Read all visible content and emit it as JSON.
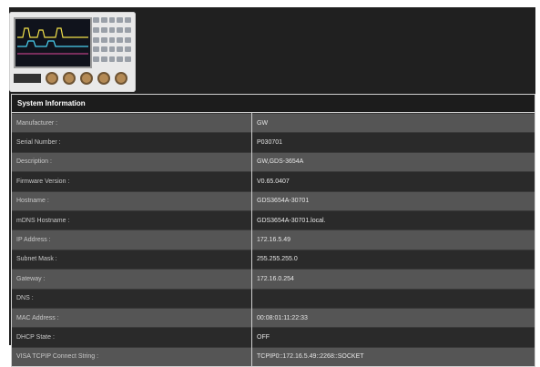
{
  "system_info": {
    "title": "System Information",
    "rows": [
      {
        "label": "Manufacturer :",
        "value": "GW"
      },
      {
        "label": "Serial Number :",
        "value": "P030701"
      },
      {
        "label": "Description :",
        "value": "GW,GDS-3654A"
      },
      {
        "label": "Firmware Version :",
        "value": "V0.65.0407"
      },
      {
        "label": "Hostname :",
        "value": "GDS3654A-30701"
      },
      {
        "label": "mDNS Hostname :",
        "value": "GDS3654A-30701.local."
      },
      {
        "label": "IP Address :",
        "value": "172.16.5.49"
      },
      {
        "label": "Subnet Mask :",
        "value": "255.255.255.0"
      },
      {
        "label": "Gateway :",
        "value": "172.16.0.254"
      },
      {
        "label": "DNS :",
        "value": ""
      },
      {
        "label": "MAC Address :",
        "value": "00:08:01:11:22:33"
      },
      {
        "label": "DHCP State :",
        "value": "OFF"
      },
      {
        "label": "VISA TCPIP Connect String :",
        "value": "TCPIP0::172.16.5.49::2268::SOCKET"
      }
    ]
  }
}
